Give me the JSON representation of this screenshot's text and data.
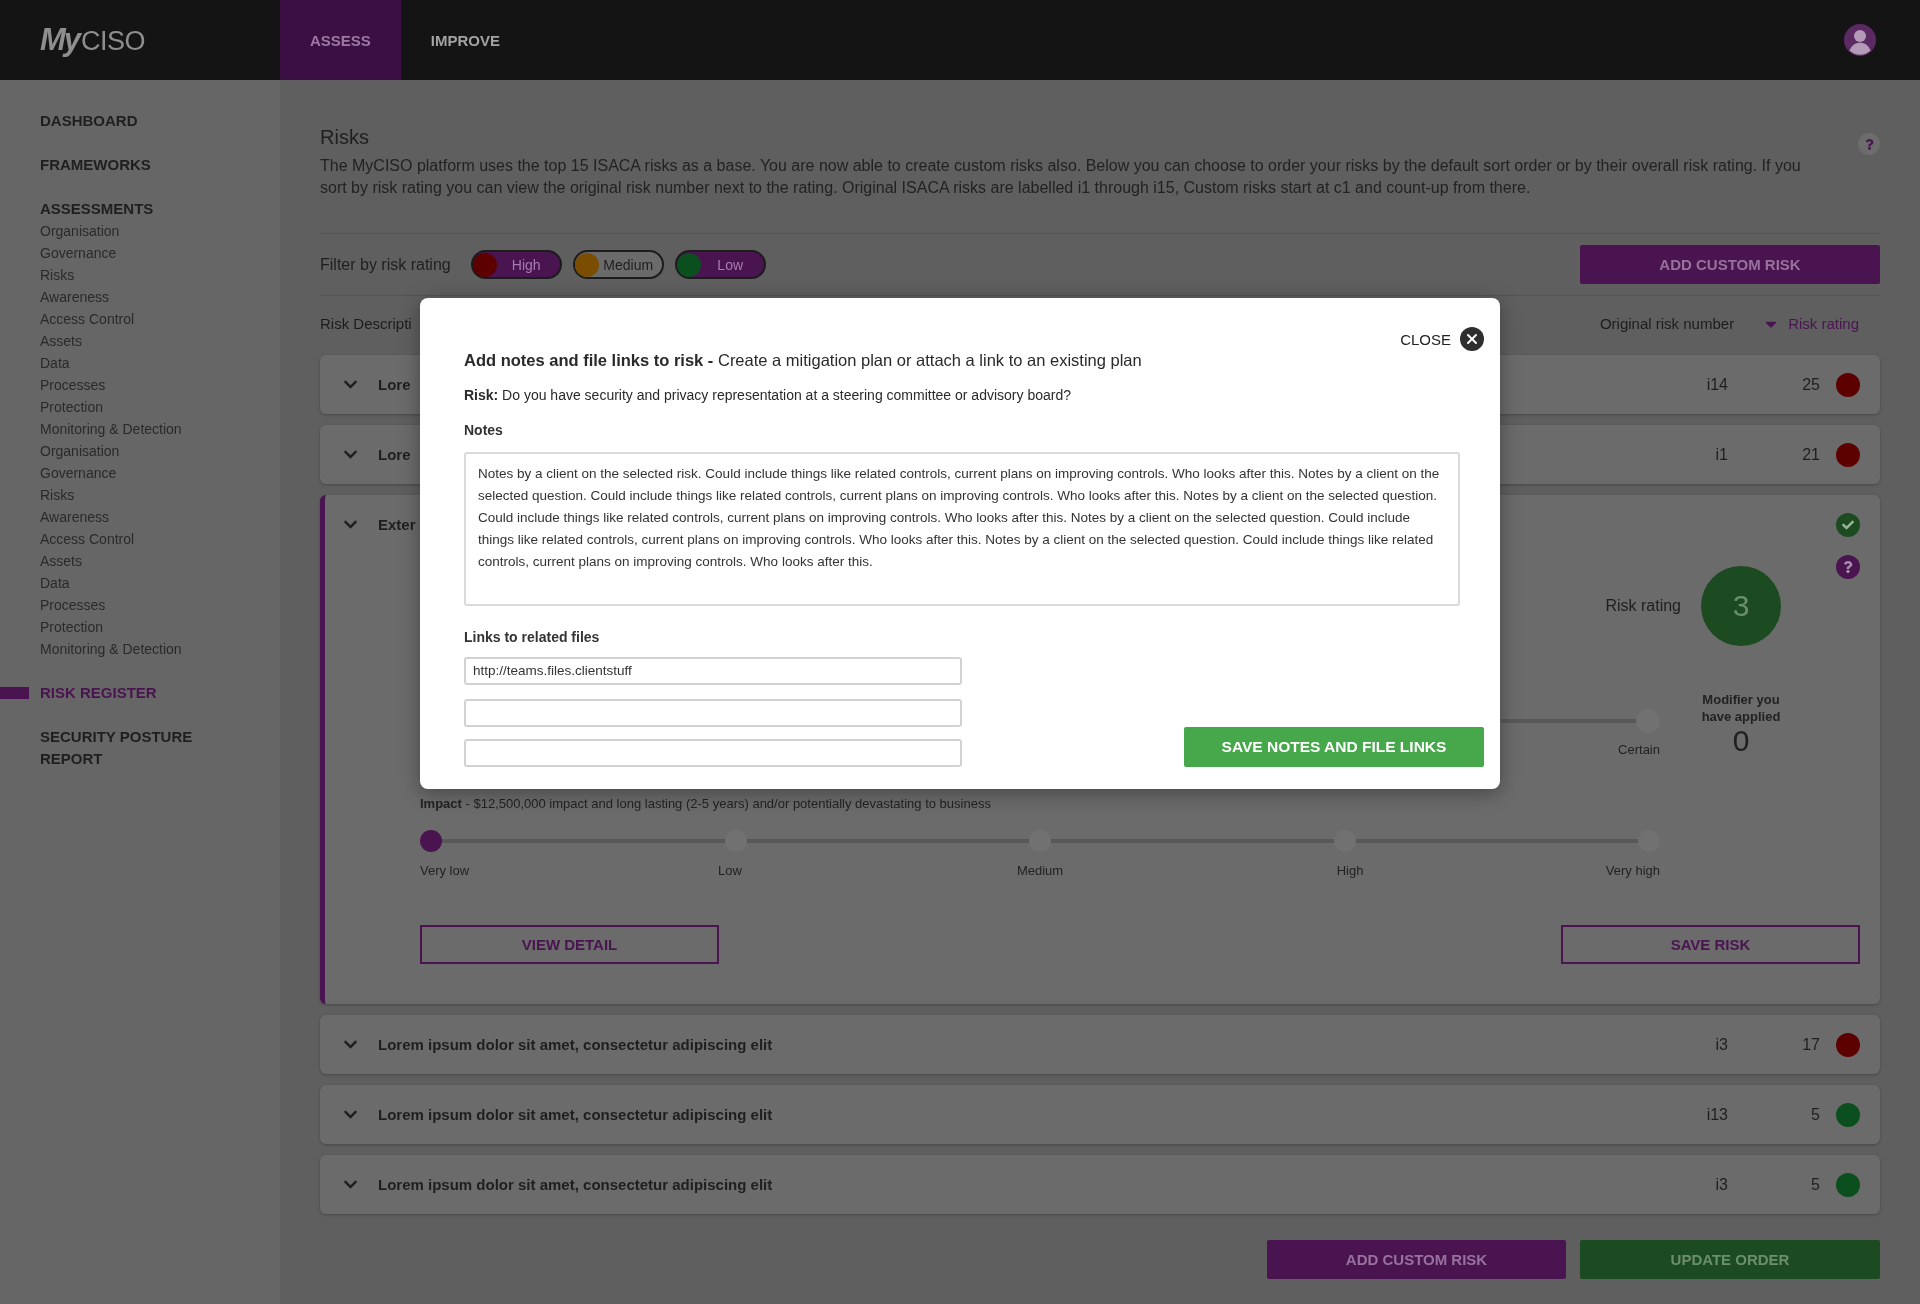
{
  "header": {
    "logo": "**My**CISO",
    "tabs": [
      {
        "label": "ASSESS",
        "selected": true
      },
      {
        "label": "IMPROVE",
        "selected": false
      }
    ]
  },
  "sidebar": {
    "items": [
      {
        "label": "DASHBOARD",
        "selected": false
      },
      {
        "label": "FRAMEWORKS",
        "selected": false
      },
      {
        "label": "ASSESSMENTS",
        "selected": false,
        "children": [
          {
            "label": "Organisation"
          },
          {
            "label": "Governance"
          },
          {
            "label": "Risks"
          },
          {
            "label": "Awareness"
          },
          {
            "label": "Access Control"
          },
          {
            "label": "Assets"
          },
          {
            "label": "Data"
          },
          {
            "label": "Processes"
          },
          {
            "label": "Protection"
          },
          {
            "label": "Monitoring & Detection"
          },
          {
            "label": "Organisation"
          },
          {
            "label": "Governance"
          },
          {
            "label": "Risks"
          },
          {
            "label": "Awareness"
          },
          {
            "label": "Access Control"
          },
          {
            "label": "Assets"
          },
          {
            "label": "Data"
          },
          {
            "label": "Processes"
          },
          {
            "label": "Protection"
          },
          {
            "label": "Monitoring & Detection"
          }
        ]
      },
      {
        "label": "RISK REGISTER",
        "selected": true
      },
      {
        "label": "SECURITY POSTURE REPORT",
        "selected": false
      }
    ]
  },
  "page": {
    "title": "Risks",
    "description": "The MyCISO platform uses the top 15 ISACA risks as a base. You are now able to create custom risks also. Below you can choose to order your risks by the default sort order or by their overall risk rating. If you sort by risk rating you can view the original risk number next to the rating. Original ISACA risks are labelled i1 through i15, Custom risks start at c1 and count-up from there.",
    "filter": {
      "label": "Filter by risk rating",
      "options": [
        {
          "label": "High",
          "selected": true,
          "color": "#5c0000"
        },
        {
          "label": "Medium",
          "selected": false,
          "color": "#7a4d00"
        },
        {
          "label": "Low",
          "selected": true,
          "color": "#0b4f1f"
        }
      ]
    },
    "add_button": "ADD CUSTOM RISK"
  },
  "table": {
    "columns": [
      {
        "label": "Risk Descripti",
        "sorted": false
      },
      {
        "label": "Original risk number",
        "sorted": false
      },
      {
        "label": "Risk rating",
        "sorted": true
      }
    ],
    "rows": [
      {
        "title": "Lore",
        "number": "i14",
        "rating": "25",
        "color": "#5c0000",
        "expanded": false
      },
      {
        "title": "Lore",
        "number": "i1",
        "rating": "21",
        "color": "#5c0000",
        "expanded": false
      },
      {
        "title": "Exter",
        "expanded": true,
        "detail": {
          "risk_rating_label": "Risk rating",
          "risk_rating": "3",
          "modifier_label": "Modifier you have applied",
          "modifier": "0",
          "likelihood": {
            "stops": [
              {
                "label": "Certain",
                "selected": false
              }
            ]
          },
          "impact": {
            "text": "**Impact** - $12,500,000 impact and long lasting (2-5 years) and/or potentially devastating to business",
            "stops": [
              {
                "label": "Very low",
                "selected": true
              },
              {
                "label": "Low",
                "selected": false
              },
              {
                "label": "Medium",
                "selected": false
              },
              {
                "label": "High",
                "selected": false
              },
              {
                "label": "Very high",
                "selected": false
              }
            ]
          },
          "buttons": [
            "VIEW DETAIL",
            "SAVE RISK"
          ]
        }
      },
      {
        "title": "Lorem ipsum dolor sit amet, consectetur adipiscing elit",
        "number": "i3",
        "rating": "17",
        "color": "#5c0000",
        "expanded": false
      },
      {
        "title": "Lorem ipsum dolor sit amet, consectetur adipiscing elit",
        "number": "i13",
        "rating": "5",
        "color": "#0b4f1f",
        "expanded": false
      },
      {
        "title": "Lorem ipsum dolor sit amet, consectetur adipiscing elit",
        "number": "i3",
        "rating": "5",
        "color": "#0b4f1f",
        "expanded": false
      }
    ]
  },
  "footer_buttons": [
    {
      "label": "ADD CUSTOM RISK",
      "kind": "primary"
    },
    {
      "label": "UPDATE ORDER",
      "kind": "success"
    }
  ],
  "modal": {
    "close_label": "CLOSE",
    "title": "**Add notes and file links to risk -** Create a mitigation plan or attach a link to an existing plan",
    "risk": "**Risk:** Do you have security and privacy representation at a steering committee or advisory board?",
    "notes_label": "Notes",
    "notes": "Notes by a client on the selected risk. Could include things like related controls, current plans on improving controls. Who looks after this. Notes by a client on the selected question. Could include things like related controls, current plans on improving controls. Who looks after this. Notes by a client on the selected question. Could include things like related controls, current plans on improving controls. Who looks after this. Notes by a client on the selected question. Could include things like related controls, current plans on improving controls. Who looks after this. Notes by a client on the selected question. Could include things like related controls, current plans on improving controls. Who looks after this.",
    "links_label": "Links to related files",
    "links": [
      {
        "kind": "filled",
        "value": "http://teams.files.clientstuff"
      },
      {
        "kind": "empty"
      },
      {
        "kind": "empty"
      }
    ],
    "save_button": "SAVE NOTES AND FILE LINKS"
  }
}
